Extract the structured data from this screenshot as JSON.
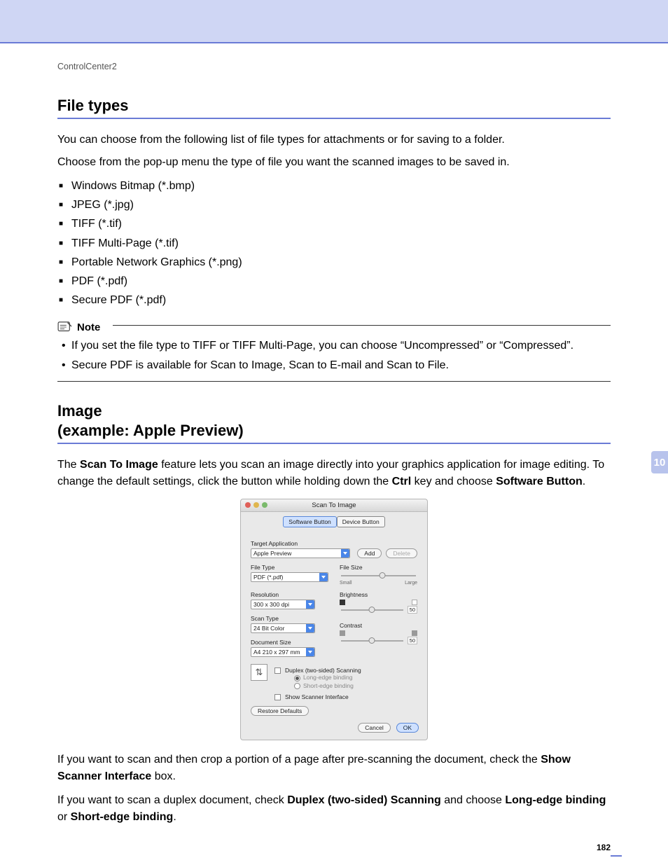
{
  "breadcrumb": "ControlCenter2",
  "section1_title": "File types",
  "para1": "You can choose from the following list of file types for attachments or for saving to a folder.",
  "para2": "Choose from the pop-up menu the type of file you want the scanned images to be saved in.",
  "file_types": [
    "Windows Bitmap (*.bmp)",
    "JPEG (*.jpg)",
    "TIFF (*.tif)",
    "TIFF Multi-Page (*.tif)",
    "Portable Network Graphics (*.png)",
    "PDF (*.pdf)",
    "Secure PDF (*.pdf)"
  ],
  "note_label": "Note",
  "note_items": [
    "If you set the file type to TIFF or TIFF Multi-Page, you can choose “Uncompressed” or “Compressed”.",
    "Secure PDF is available for Scan to Image, Scan to E-mail and Scan to File."
  ],
  "section2_line1": "Image",
  "section2_line2": "(example: Apple Preview)",
  "para3_pre": "The ",
  "para3_b1": "Scan To Image",
  "para3_mid": " feature lets you scan an image directly into your graphics application for image editing. To change the default settings, click the button while holding down the ",
  "para3_b2": "Ctrl",
  "para3_mid2": " key and choose ",
  "para3_b3": "Software Button",
  "para3_end": ".",
  "dialog": {
    "title": "Scan To Image",
    "tabs": {
      "software": "Software Button",
      "device": "Device Button"
    },
    "target_app_label": "Target Application",
    "target_app_value": "Apple Preview",
    "add": "Add",
    "delete": "Delete",
    "file_type_label": "File Type",
    "file_type_value": "PDF (*.pdf)",
    "file_size_label": "File Size",
    "file_size_small": "Small",
    "file_size_large": "Large",
    "resolution_label": "Resolution",
    "resolution_value": "300 x 300 dpi",
    "scan_type_label": "Scan Type",
    "scan_type_value": "24 Bit Color",
    "doc_size_label": "Document Size",
    "doc_size_value": "A4  210 x 297 mm",
    "brightness_label": "Brightness",
    "brightness_value": "50",
    "contrast_label": "Contrast",
    "contrast_value": "50",
    "duplex": "Duplex (two-sided) Scanning",
    "long_edge": "Long-edge binding",
    "short_edge": "Short-edge binding",
    "show_scanner": "Show Scanner Interface",
    "restore": "Restore Defaults",
    "cancel": "Cancel",
    "ok": "OK"
  },
  "para4_pre": "If you want to scan and then crop a portion of a page after pre-scanning the document, check the ",
  "para4_b": "Show Scanner Interface",
  "para4_end": " box.",
  "para5_pre": "If you want to scan a duplex document, check ",
  "para5_b1": "Duplex (two-sided) Scanning",
  "para5_mid": " and choose ",
  "para5_b2": "Long-edge binding",
  "para5_or": " or ",
  "para5_b3": "Short-edge binding",
  "para5_end": ".",
  "chapter_number": "10",
  "page_number": "182"
}
